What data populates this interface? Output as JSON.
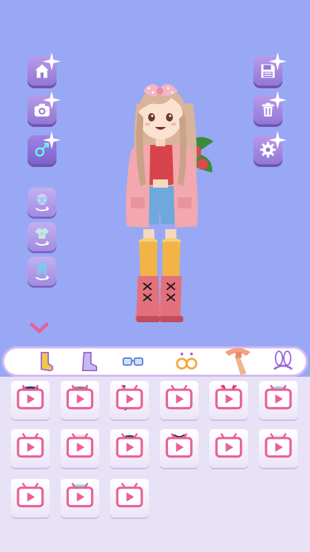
{
  "toolbar_left": [
    {
      "name": "home-button",
      "icon": "home-icon"
    },
    {
      "name": "camera-button",
      "icon": "camera-icon"
    },
    {
      "name": "gender-button",
      "icon": "gender-icon"
    }
  ],
  "toolbar_right": [
    {
      "name": "save-button",
      "icon": "save-icon"
    },
    {
      "name": "trash-button",
      "icon": "trash-icon"
    },
    {
      "name": "settings-button",
      "icon": "gear-icon"
    }
  ],
  "randomize_buttons": [
    {
      "name": "random-accessory-button",
      "icon": "glasses-shuffle-icon"
    },
    {
      "name": "random-outfit-button",
      "icon": "shirt-shuffle-icon"
    },
    {
      "name": "random-bottom-button",
      "icon": "pants-shuffle-icon"
    }
  ],
  "categories": [
    {
      "name": "socks",
      "icon": "sock-icon",
      "selected": false
    },
    {
      "name": "boots",
      "icon": "boot-icon",
      "selected": false
    },
    {
      "name": "glasses",
      "icon": "glasses-icon",
      "selected": false
    },
    {
      "name": "earrings",
      "icon": "earrings-icon",
      "selected": false
    },
    {
      "name": "scarf",
      "icon": "scarf-icon",
      "selected": true
    },
    {
      "name": "bunny-headband",
      "icon": "bunny-ears-icon",
      "selected": false
    }
  ],
  "items": [
    {
      "name": "navy-scarf",
      "icon": "scarf-icon",
      "color": "#2a3f6f"
    },
    {
      "name": "gray-knit-scarf",
      "icon": "scarf-icon",
      "color": "#8a8090"
    },
    {
      "name": "earphones",
      "icon": "earphones-icon",
      "color": "#c08060"
    },
    {
      "name": "flower-lei",
      "icon": "lei-icon",
      "color": "#f0a040"
    },
    {
      "name": "id-lanyard",
      "icon": "lanyard-icon",
      "color": "#c03030"
    },
    {
      "name": "light-blue-scarf",
      "icon": "scarf-icon",
      "color": "#a8c8e8"
    },
    {
      "name": "camera-strap",
      "icon": "camera-icon",
      "color": "#40c0c0"
    },
    {
      "name": "paw-scarf",
      "icon": "scarf-icon",
      "color": "#f0e0d0"
    },
    {
      "name": "headphones",
      "icon": "headphones-icon",
      "color": "#205040"
    },
    {
      "name": "choker",
      "icon": "choker-icon",
      "color": "#202020"
    },
    {
      "name": "blue-bow",
      "icon": "bow-icon",
      "color": "#5ab4e6"
    },
    {
      "name": "white-scarf",
      "icon": "scarf-icon",
      "color": "#e8eef4"
    },
    {
      "name": "black-bow",
      "icon": "bow-icon",
      "color": "#1a1a1a"
    },
    {
      "name": "aqua-scarf",
      "icon": "scarf-icon",
      "color": "#9ad8e8"
    },
    {
      "name": "black-ribbon",
      "icon": "ribbon-icon",
      "color": "#1a1a1a"
    }
  ],
  "colors": {
    "background": "#99a8f4",
    "button": "#9477d6",
    "panel": "#e8e2f6",
    "accent": "#e7609a"
  }
}
